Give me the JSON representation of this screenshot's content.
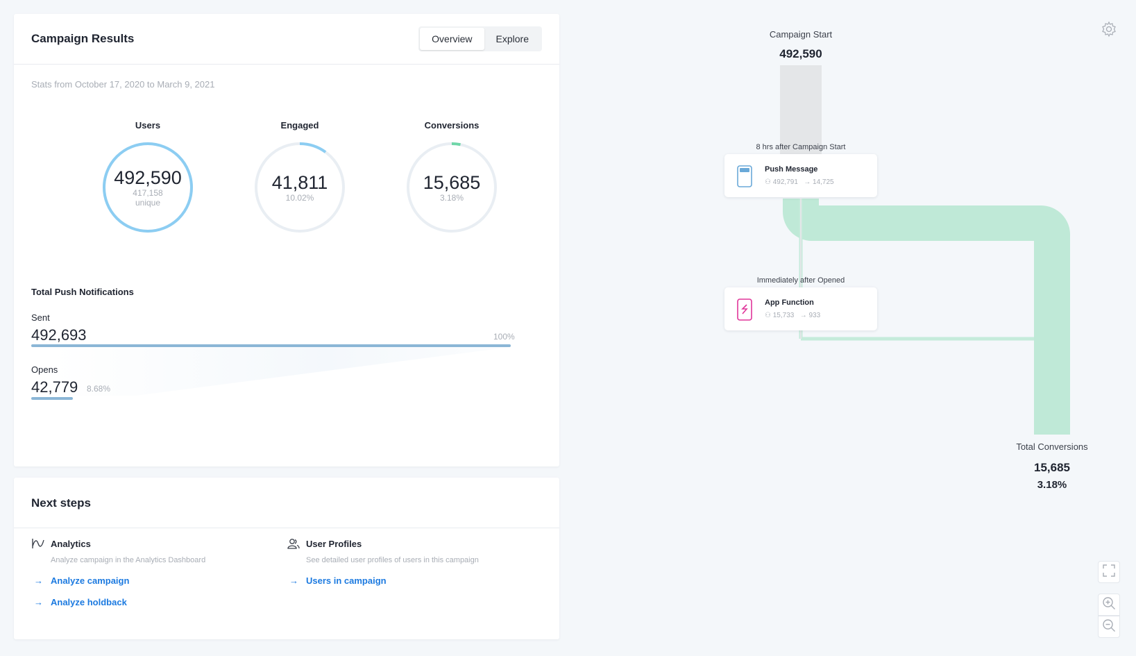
{
  "results": {
    "title": "Campaign Results",
    "tabs": [
      {
        "label": "Overview",
        "active": true
      },
      {
        "label": "Explore",
        "active": false
      }
    ],
    "stats_range": "Stats from October 17, 2020 to March 9, 2021",
    "rings": [
      {
        "label": "Users",
        "value": "492,590",
        "sub1": "417,158",
        "sub2": "unique",
        "fraction": 1.0,
        "color": "#8ccdf2"
      },
      {
        "label": "Engaged",
        "value": "41,811",
        "sub1": "10.02%",
        "sub2": "",
        "fraction": 0.1002,
        "color": "#8ccdf2"
      },
      {
        "label": "Conversions",
        "value": "15,685",
        "sub1": "3.18%",
        "sub2": "",
        "fraction": 0.0318,
        "color": "#6fd6a8"
      }
    ],
    "push": {
      "title": "Total Push Notifications",
      "sent_label": "Sent",
      "sent_value": "492,693",
      "sent_pct": "100%",
      "sent_fraction": 1.0,
      "opens_label": "Opens",
      "opens_value": "42,779",
      "opens_pct": "8.68%",
      "opens_fraction": 0.0868
    }
  },
  "next_steps": {
    "title": "Next steps",
    "analytics": {
      "title": "Analytics",
      "icon": "analytics-icon",
      "desc": "Analyze campaign in the Analytics Dashboard",
      "links": [
        "Analyze campaign",
        "Analyze holdback"
      ]
    },
    "profiles": {
      "title": "User Profiles",
      "icon": "user-profiles-icon",
      "desc": "See detailed user profiles of users in this campaign",
      "links": [
        "Users in campaign"
      ]
    }
  },
  "flow": {
    "start_label": "Campaign Start",
    "start_value": "492,590",
    "node1": {
      "caption": "8 hrs after Campaign Start",
      "title": "Push Message",
      "users": "492,791",
      "forward": "14,725",
      "icon": "phone-icon"
    },
    "node2": {
      "caption": "Immediately after Opened",
      "title": "App Function",
      "users": "15,733",
      "forward": "933",
      "icon": "app-function-icon"
    },
    "end_label": "Total Conversions",
    "end_value": "15,685",
    "end_pct": "3.18%",
    "colors": {
      "gray_flow": "#e4e6e8",
      "green_flow": "#bfe9d7",
      "green_line": "#c5ebdb"
    }
  }
}
